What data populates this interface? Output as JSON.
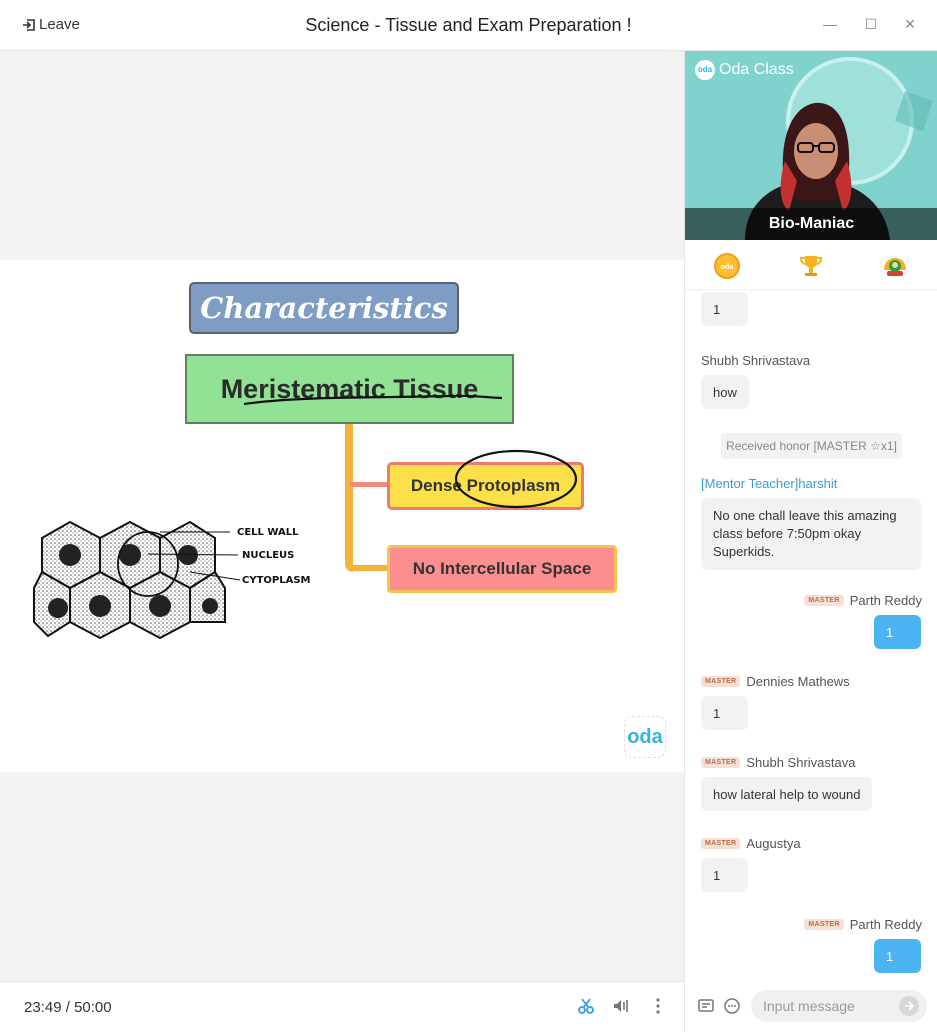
{
  "window": {
    "title": "Science - Tissue and Exam Preparation !",
    "leave_label": "Leave",
    "minimize_glyph": "—",
    "maximize_glyph": "☐",
    "close_glyph": "✕"
  },
  "slide": {
    "heading": "Characteristics",
    "main_box": "Meristematic Tissue",
    "branch_1": "Dense Protoplasm",
    "branch_2": "No Intercellular Space",
    "diagram_labels": [
      "CELL WALL",
      "NUCLEUS",
      "CYTOPLASM"
    ],
    "watermark": "oda"
  },
  "player": {
    "current_time": "23:49",
    "separator": " / ",
    "duration": "50:00",
    "icons": [
      "scissors-icon",
      "volume-icon",
      "more-vertical-icon"
    ]
  },
  "video": {
    "brand": "Oda Class",
    "brand_logo_text": "oda",
    "teacher_name": "Bio-Maniac"
  },
  "tabs": [
    {
      "name": "tab-oda-coin",
      "icon": "oda-coin-icon"
    },
    {
      "name": "tab-trophy",
      "icon": "trophy-icon"
    },
    {
      "name": "tab-honor",
      "icon": "honor-badge-icon"
    }
  ],
  "chat": {
    "first_bubble": "1",
    "msg1_sender": "Shubh Shrivastava",
    "msg1_text": "how",
    "system_text": "Received honor [MASTER ☆x1]",
    "msg2_sender": "[Mentor Teacher]harshit",
    "msg2_text": "No one chall leave this amazing class before 7:50pm okay Superkids.",
    "msg3_badge": "MASTER",
    "msg3_sender": "Parth Reddy",
    "msg3_text": "1",
    "msg4_badge": "MASTER",
    "msg4_sender": "Dennies Mathews",
    "msg4_text": "1",
    "msg5_badge": "MASTER",
    "msg5_sender": "Shubh Shrivastava",
    "msg5_text": "how lateral help to wound",
    "msg6_badge": "MASTER",
    "msg6_sender": "Augustya",
    "msg6_text": "1",
    "msg7_badge": "MASTER",
    "msg7_sender": "Parth Reddy",
    "msg7_text": "1"
  },
  "input": {
    "placeholder": "Input message",
    "icons": [
      "notice-icon",
      "emoji-icon",
      "send-icon"
    ]
  },
  "colors": {
    "accent_blue": "#4db4f4",
    "mentor_blue": "#3a9bdc",
    "brand_teal": "#34b6d8",
    "master_badge": "#f6dfd3"
  }
}
